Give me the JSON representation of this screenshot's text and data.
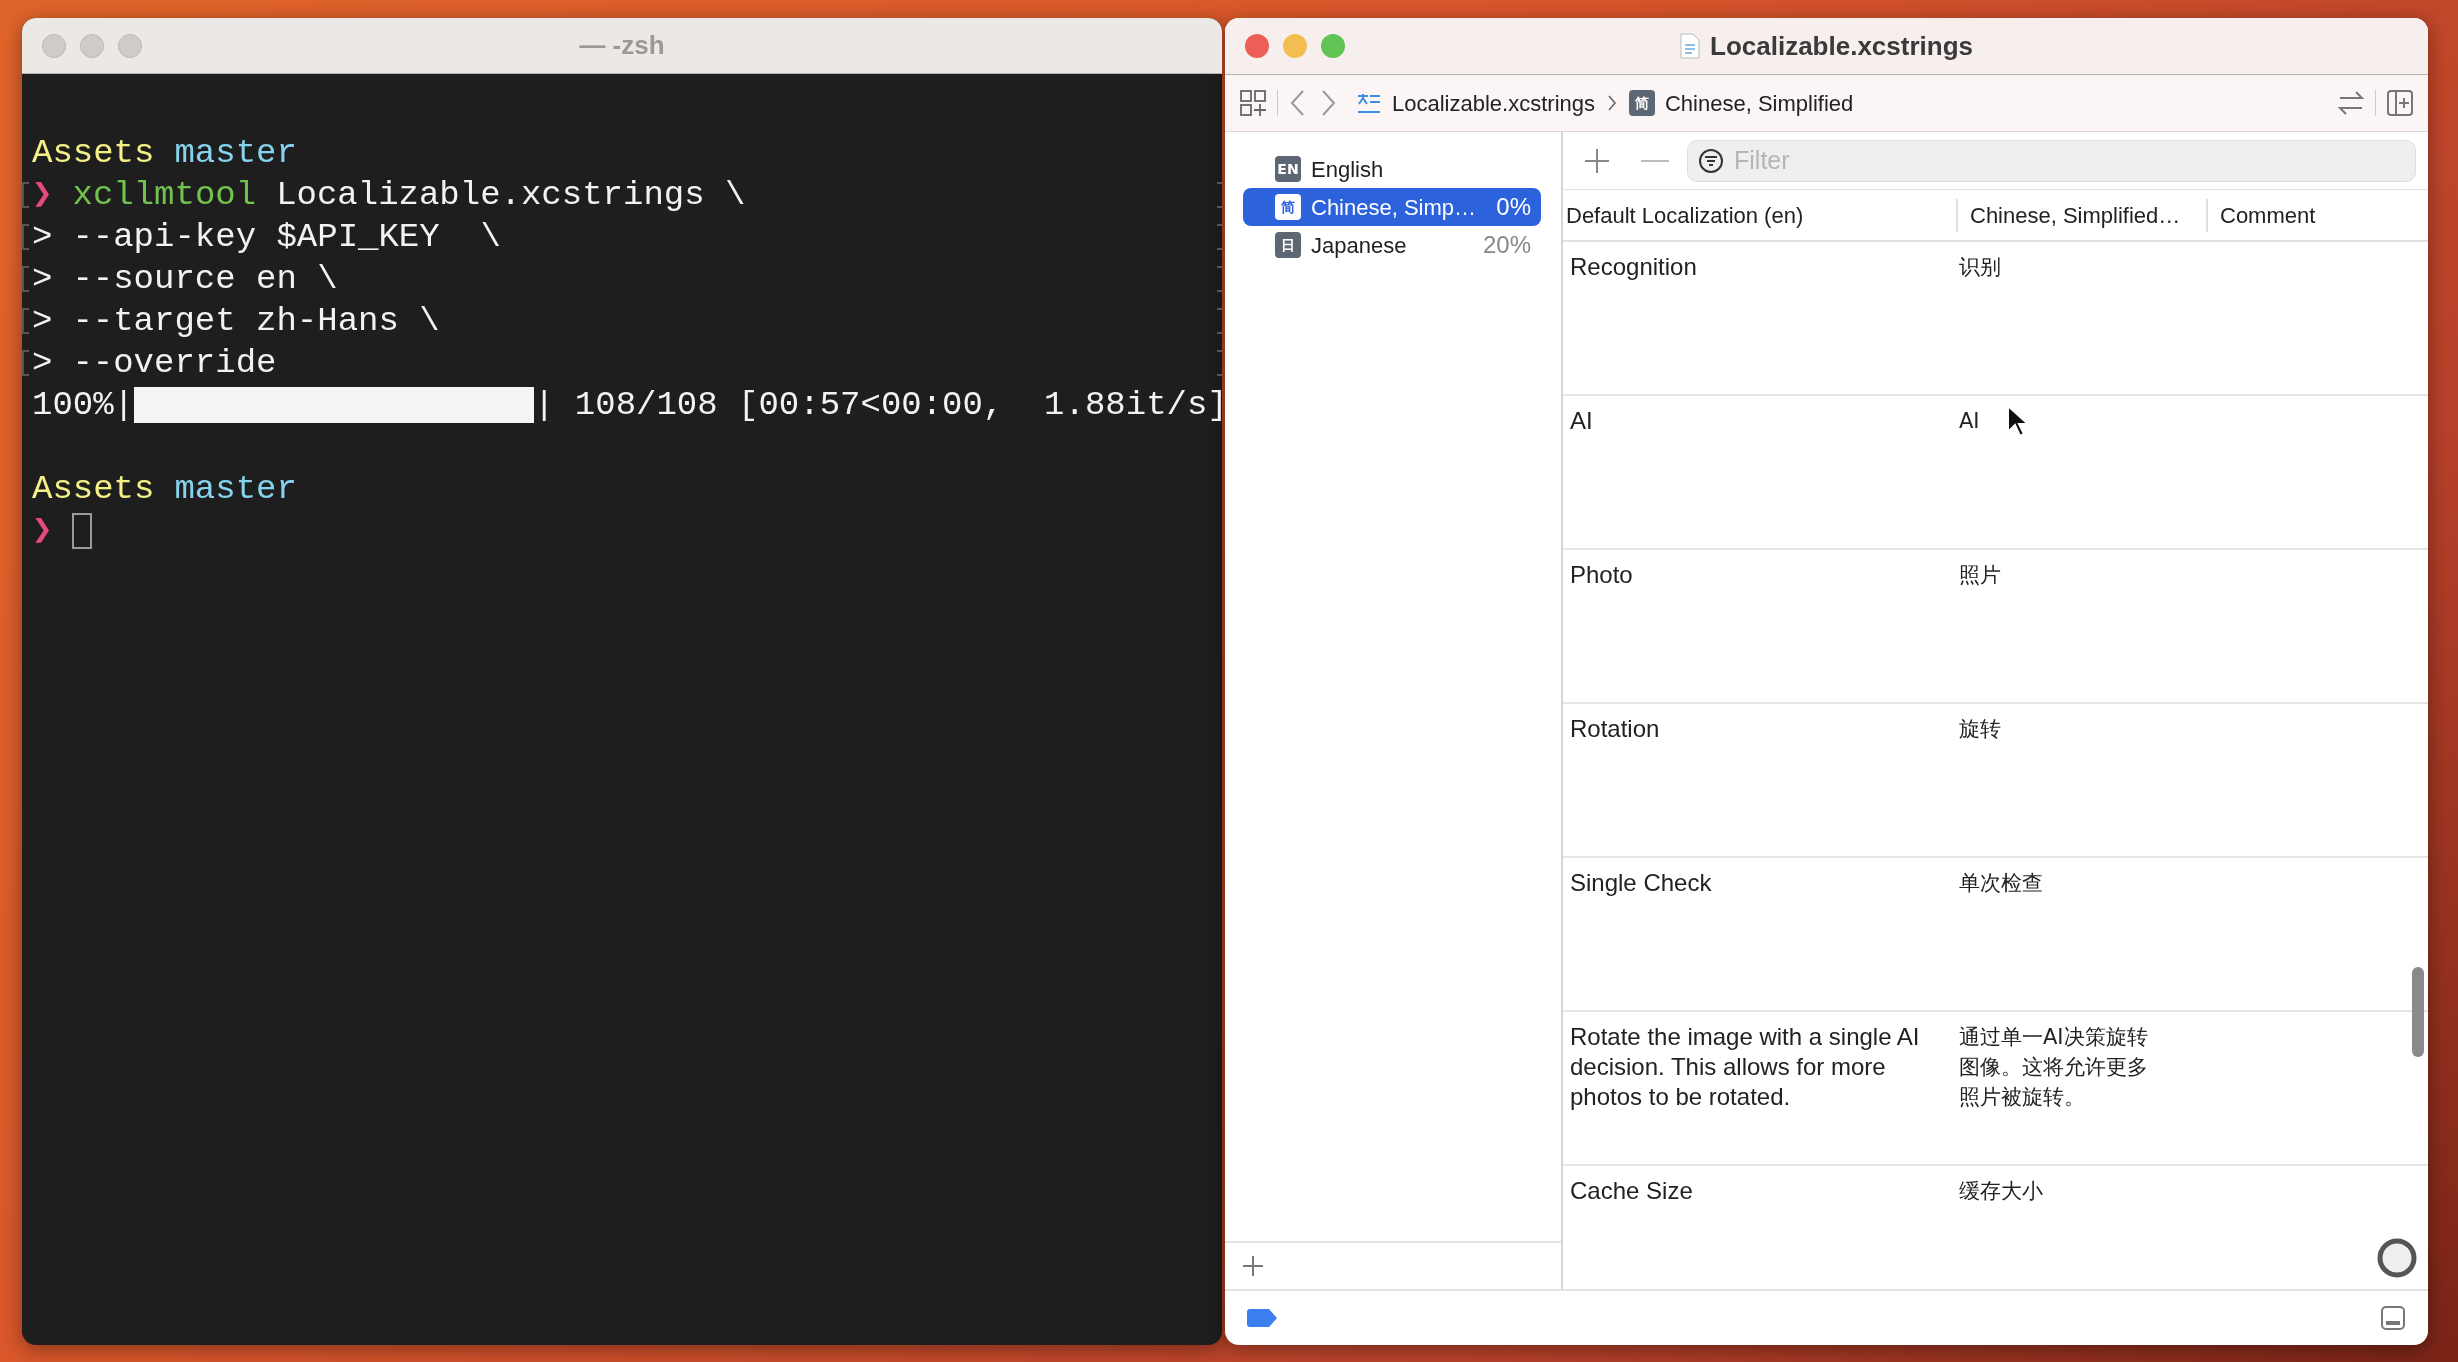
{
  "terminal": {
    "title": "— -zsh",
    "focused": false,
    "lines": [
      {
        "kind": "prompt",
        "dir": "Assets",
        "branch": "master",
        "marked": false
      },
      {
        "kind": "command",
        "marker": "❯",
        "program": "xcllmtool",
        "text": "Localizable.xcstrings \\",
        "marked": true
      },
      {
        "kind": "continuation",
        "marker": ">",
        "text": "--api-key $API_KEY  \\",
        "marked": true
      },
      {
        "kind": "continuation",
        "marker": ">",
        "text": "--source en \\",
        "marked": true
      },
      {
        "kind": "continuation",
        "marker": ">",
        "text": "--target zh-Hans \\",
        "marked": true
      },
      {
        "kind": "continuation",
        "marker": ">",
        "text": "--override",
        "marked": true
      },
      {
        "kind": "progress",
        "text": "100%|",
        "level": 1,
        "tail": "| 108/108 [00:57<00:00,  1.88it/s]",
        "marked": false
      },
      {
        "kind": "blank",
        "marked": false
      },
      {
        "kind": "prompt",
        "dir": "Assets",
        "branch": "master",
        "marked": false
      },
      {
        "kind": "input",
        "marker": "❯",
        "marked": false
      }
    ]
  },
  "editor": {
    "title": "Localizable.xcstrings",
    "focused": true,
    "breadcrumb": [
      {
        "kind": "file",
        "label": "Localizable.xcstrings"
      },
      {
        "kind": "language",
        "badge": "简",
        "label": "Chinese, Simplified"
      }
    ],
    "languages": [
      {
        "badge": "EN",
        "name": "English",
        "selected": false
      },
      {
        "badge": "简",
        "name": "Chinese, Simp…",
        "percent": "0%",
        "selected": true
      },
      {
        "badge": "日",
        "name": "Japanese",
        "percent": "20%",
        "selected": false
      }
    ],
    "filter": {
      "placeholder": "Filter"
    },
    "columns": [
      "Default Localization (en)",
      "Chinese, Simplified…",
      "Comment"
    ],
    "rows": [
      {
        "source": "Recognition",
        "translation": "识别"
      },
      {
        "source": "AI",
        "translation": "AI"
      },
      {
        "source": "Photo",
        "translation": "照片"
      },
      {
        "source": "Rotation",
        "translation": "旋转"
      },
      {
        "source": "Single Check",
        "translation": "单次检查"
      },
      {
        "source": "Rotate the image with a single AI decision. This allows for more photos to be rotated.",
        "translation": "通过单一AI决策旋转图像。这将允许更多照片被旋转。"
      },
      {
        "source": "Cache Size",
        "translation": "缓存大小"
      }
    ]
  }
}
